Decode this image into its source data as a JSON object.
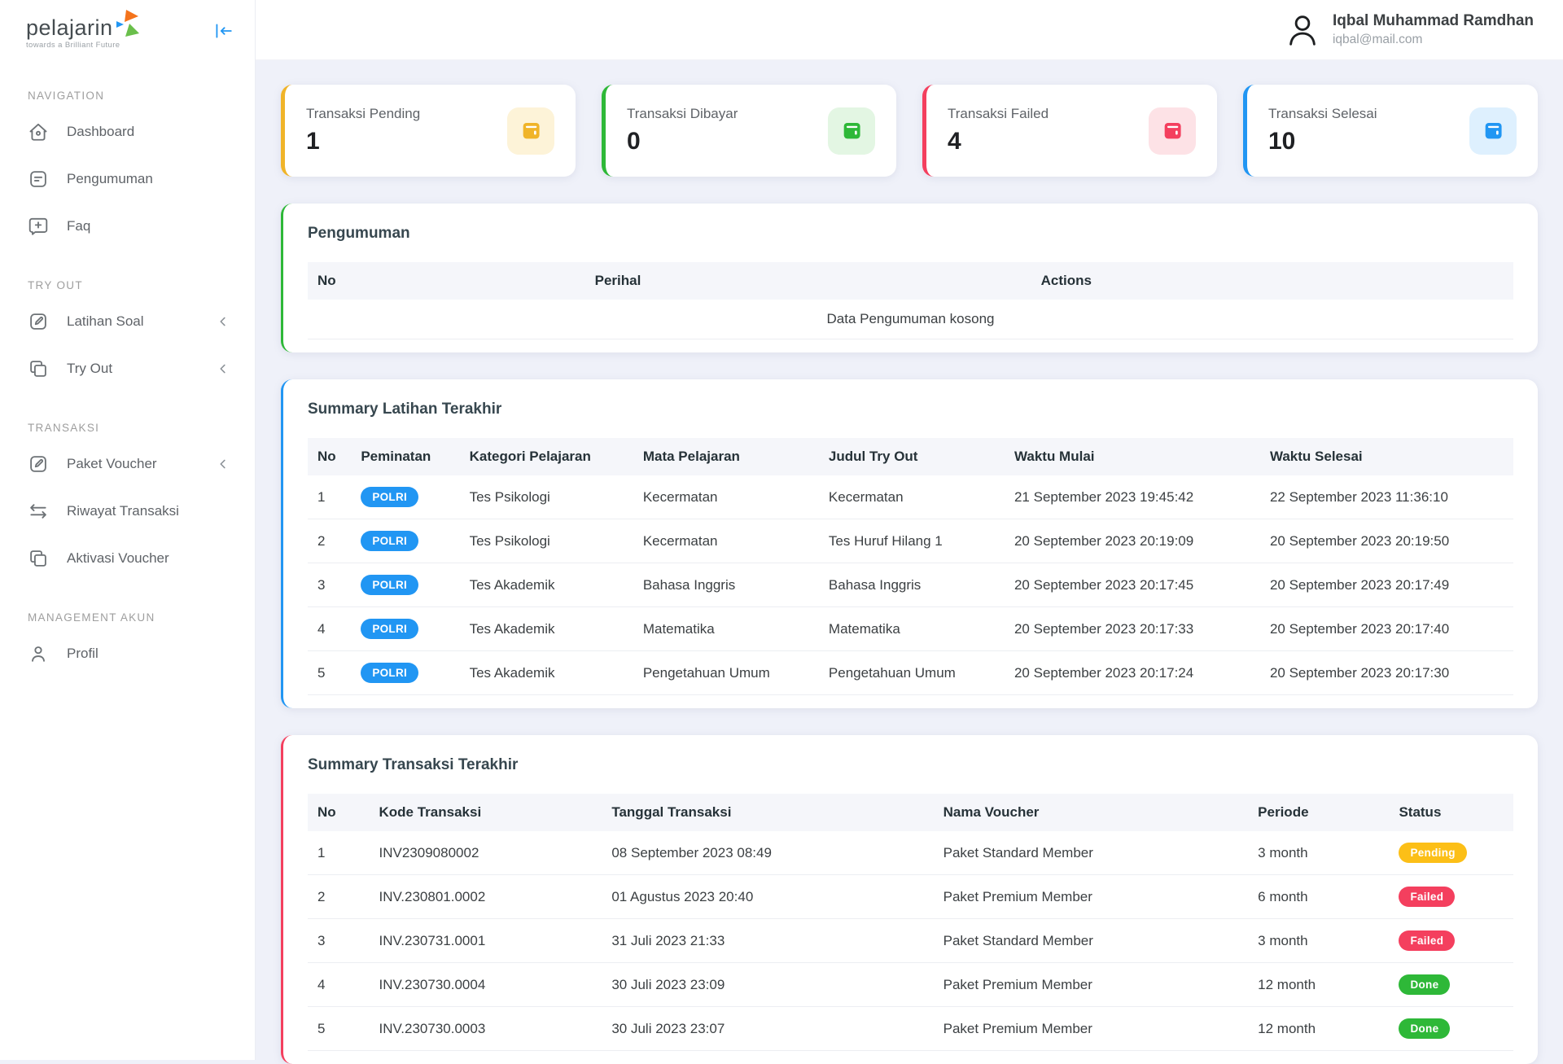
{
  "brand": {
    "name": "pelajarin",
    "tagline": "towards a Brilliant Future"
  },
  "header": {
    "user": {
      "name": "Iqbal Muhammad Ramdhan",
      "email": "iqbal@mail.com"
    }
  },
  "sidebar": {
    "sections": [
      {
        "title": "NAVIGATION",
        "items": [
          {
            "label": "Dashboard",
            "icon": "home-icon"
          },
          {
            "label": "Pengumuman",
            "icon": "note-icon"
          },
          {
            "label": "Faq",
            "icon": "faq-icon"
          }
        ]
      },
      {
        "title": "TRY OUT",
        "items": [
          {
            "label": "Latihan Soal",
            "icon": "edit-icon",
            "chevron": true
          },
          {
            "label": "Try Out",
            "icon": "copy-icon",
            "chevron": true
          }
        ]
      },
      {
        "title": "TRANSAKSI",
        "items": [
          {
            "label": "Paket Voucher",
            "icon": "edit-icon",
            "chevron": true
          },
          {
            "label": "Riwayat Transaksi",
            "icon": "exchange-icon"
          },
          {
            "label": "Aktivasi Voucher",
            "icon": "copy-icon"
          }
        ]
      },
      {
        "title": "MANAGEMENT AKUN",
        "items": [
          {
            "label": "Profil",
            "icon": "user-icon"
          }
        ]
      }
    ]
  },
  "stats": [
    {
      "label": "Transaksi Pending",
      "value": "1",
      "accent": "#f0b429",
      "tint": "#fdf3d8",
      "icon": "wallet-icon"
    },
    {
      "label": "Transaksi Dibayar",
      "value": "0",
      "accent": "#2eb838",
      "tint": "#e3f6e3",
      "icon": "wallet-icon"
    },
    {
      "label": "Transaksi Failed",
      "value": "4",
      "accent": "#f43f5e",
      "tint": "#fde2e6",
      "icon": "wallet-icon"
    },
    {
      "label": "Transaksi Selesai",
      "value": "10",
      "accent": "#2196f3",
      "tint": "#def0fe",
      "icon": "wallet-icon"
    }
  ],
  "pengumuman": {
    "title": "Pengumuman",
    "accent": "#2eb838",
    "columns": [
      "No",
      "Perihal",
      "Actions"
    ],
    "empty": "Data Pengumuman kosong"
  },
  "latihan": {
    "title": "Summary Latihan Terakhir",
    "accent": "#2196f3",
    "badge_color": "#2196f3",
    "columns": [
      "No",
      "Peminatan",
      "Kategori Pelajaran",
      "Mata Pelajaran",
      "Judul Try Out",
      "Waktu Mulai",
      "Waktu Selesai"
    ],
    "rows": [
      {
        "no": "1",
        "peminatan": "POLRI",
        "kategori": "Tes Psikologi",
        "mata": "Kecermatan",
        "judul": "Kecermatan",
        "mulai": "21 September 2023 19:45:42",
        "selesai": "22 September 2023 11:36:10"
      },
      {
        "no": "2",
        "peminatan": "POLRI",
        "kategori": "Tes Psikologi",
        "mata": "Kecermatan",
        "judul": "Tes Huruf Hilang 1",
        "mulai": "20 September 2023 20:19:09",
        "selesai": "20 September 2023 20:19:50"
      },
      {
        "no": "3",
        "peminatan": "POLRI",
        "kategori": "Tes Akademik",
        "mata": "Bahasa Inggris",
        "judul": "Bahasa Inggris",
        "mulai": "20 September 2023 20:17:45",
        "selesai": "20 September 2023 20:17:49"
      },
      {
        "no": "4",
        "peminatan": "POLRI",
        "kategori": "Tes Akademik",
        "mata": "Matematika",
        "judul": "Matematika",
        "mulai": "20 September 2023 20:17:33",
        "selesai": "20 September 2023 20:17:40"
      },
      {
        "no": "5",
        "peminatan": "POLRI",
        "kategori": "Tes Akademik",
        "mata": "Pengetahuan Umum",
        "judul": "Pengetahuan Umum",
        "mulai": "20 September 2023 20:17:24",
        "selesai": "20 September 2023 20:17:30"
      }
    ]
  },
  "transaksi": {
    "title": "Summary Transaksi Terakhir",
    "accent": "#f43f5e",
    "columns": [
      "No",
      "Kode Transaksi",
      "Tanggal Transaksi",
      "Nama Voucher",
      "Periode",
      "Status"
    ],
    "status_colors": {
      "Pending": "#fcbf17",
      "Failed": "#f43f5e",
      "Done": "#2eb838"
    },
    "rows": [
      {
        "no": "1",
        "kode": "INV2309080002",
        "tanggal": "08 September 2023 08:49",
        "voucher": "Paket Standard Member",
        "periode": "3 month",
        "status": "Pending"
      },
      {
        "no": "2",
        "kode": "INV.230801.0002",
        "tanggal": "01 Agustus 2023 20:40",
        "voucher": "Paket Premium Member",
        "periode": "6 month",
        "status": "Failed"
      },
      {
        "no": "3",
        "kode": "INV.230731.0001",
        "tanggal": "31 Juli 2023 21:33",
        "voucher": "Paket Standard Member",
        "periode": "3 month",
        "status": "Failed"
      },
      {
        "no": "4",
        "kode": "INV.230730.0004",
        "tanggal": "30 Juli 2023 23:09",
        "voucher": "Paket Premium Member",
        "periode": "12 month",
        "status": "Done"
      },
      {
        "no": "5",
        "kode": "INV.230730.0003",
        "tanggal": "30 Juli 2023 23:07",
        "voucher": "Paket Premium Member",
        "periode": "12 month",
        "status": "Done"
      }
    ]
  }
}
